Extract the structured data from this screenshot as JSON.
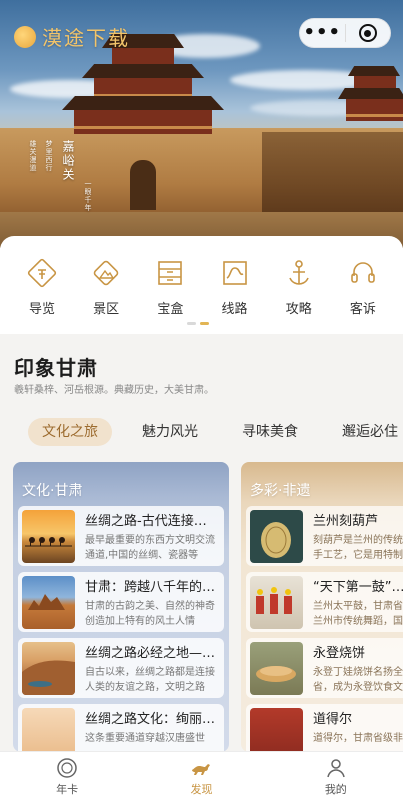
{
  "hero": {
    "logo_text": "漠途下载",
    "capsule_more": "•••",
    "calligraphy_main": "嘉峪关",
    "calligraphy_line2": "梦里西行",
    "calligraphy_line3": "一眼千年",
    "calligraphy_line4": "雄关漫道"
  },
  "nav": {
    "items": [
      {
        "label": "导览",
        "icon": "guide-icon"
      },
      {
        "label": "景区",
        "icon": "scenic-icon"
      },
      {
        "label": "宝盒",
        "icon": "treasure-box-icon"
      },
      {
        "label": "线路",
        "icon": "route-icon"
      },
      {
        "label": "攻略",
        "icon": "anchor-icon"
      },
      {
        "label": "客诉",
        "icon": "headset-icon"
      }
    ]
  },
  "section": {
    "title": "印象甘肃",
    "subtitle": "羲轩桑梓、河岳根源。典藏历史，大美甘肃。",
    "tabs": [
      "文化之旅",
      "魅力风光",
      "寻味美食",
      "邂逅必住"
    ],
    "active_tab": "文化之旅"
  },
  "left_panel": {
    "heading": "文化·甘肃",
    "items": [
      {
        "title": "丝绸之路-古代连接东西方文化的纽带",
        "desc": "最早最重要的东西方文明交流通道,中国的丝绸、瓷器等"
      },
      {
        "title": "甘肃：跨越八千年的历史长河",
        "desc": "甘肃的古韵之美、自然的神奇创造加上特有的风土人情"
      },
      {
        "title": "丝绸之路必经之地—敦煌",
        "desc": "自古以来，丝绸之路都是连接人类的友谊之路，文明之路"
      },
      {
        "title": "丝绸之路文化：绚丽多彩",
        "desc": "这条重要通道穿越汉唐盛世"
      }
    ]
  },
  "right_panel": {
    "heading": "多彩·非遗",
    "items": [
      {
        "title": "兰州刻葫芦",
        "desc": "刻葫芦是兰州的传统手工艺，它是用特制的"
      },
      {
        "title": "“天下第一鼓”—兰州太平鼓",
        "desc": "兰州太平鼓，甘肃省兰州市传统舞蹈，国家级"
      },
      {
        "title": "永登烧饼",
        "desc": "永登丁娃烧饼名扬全省，成为永登饮食文化的"
      },
      {
        "title": "道得尔",
        "desc": "道得尔，甘肃省级非"
      }
    ]
  },
  "tabbar": {
    "items": [
      {
        "label": "年卡",
        "icon": "annual-card-icon"
      },
      {
        "label": "发现",
        "icon": "discover-horse-icon"
      },
      {
        "label": "我的",
        "icon": "profile-icon"
      }
    ],
    "active": "发现"
  },
  "colors": {
    "accent": "#c89544",
    "tab_active_bg": "#f1e2cd",
    "tab_active_text": "#9c6b2e"
  }
}
